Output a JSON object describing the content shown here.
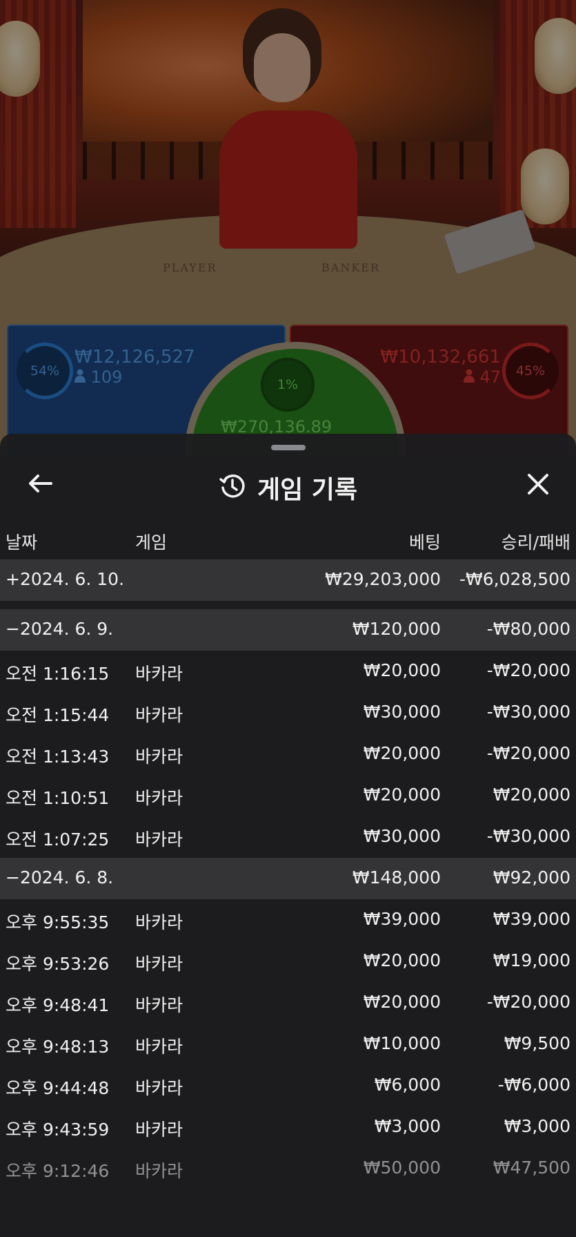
{
  "live": {
    "table_labels": {
      "player": "PLAYER",
      "banker": "BANKER"
    },
    "player_panel": {
      "percent": "54%",
      "amount": "₩12,126,527",
      "players": "109"
    },
    "banker_panel": {
      "percent": "45%",
      "amount": "₩10,132,661",
      "players": "47"
    },
    "tie_panel": {
      "percent": "1%",
      "amount": "₩270,136.89"
    }
  },
  "sheet": {
    "title": "게임 기록",
    "icons": {
      "back": "arrow-left-icon",
      "history": "history-icon",
      "close": "close-icon",
      "user": "user-icon"
    },
    "columns": {
      "date": "날짜",
      "game": "게임",
      "bet": "베팅",
      "win_loss": "승리/패배"
    },
    "rows": [
      {
        "type": "day",
        "date": "+2024. 6. 10.",
        "game": "",
        "bet": "₩29,203,000",
        "win_loss": "-₩6,028,500"
      },
      {
        "type": "day",
        "date": "−2024. 6. 9.",
        "game": "",
        "bet": "₩120,000",
        "win_loss": "-₩80,000"
      },
      {
        "type": "entry",
        "date": "오전 1:16:15",
        "game": "바카라",
        "bet": "₩20,000",
        "win_loss": "-₩20,000"
      },
      {
        "type": "entry",
        "date": "오전 1:15:44",
        "game": "바카라",
        "bet": "₩30,000",
        "win_loss": "-₩30,000"
      },
      {
        "type": "entry",
        "date": "오전 1:13:43",
        "game": "바카라",
        "bet": "₩20,000",
        "win_loss": "-₩20,000"
      },
      {
        "type": "entry",
        "date": "오전 1:10:51",
        "game": "바카라",
        "bet": "₩20,000",
        "win_loss": "₩20,000"
      },
      {
        "type": "entry",
        "date": "오전 1:07:25",
        "game": "바카라",
        "bet": "₩30,000",
        "win_loss": "-₩30,000"
      },
      {
        "type": "day",
        "date": "−2024. 6. 8.",
        "game": "",
        "bet": "₩148,000",
        "win_loss": "₩92,000"
      },
      {
        "type": "entry",
        "date": "오후 9:55:35",
        "game": "바카라",
        "bet": "₩39,000",
        "win_loss": "₩39,000"
      },
      {
        "type": "entry",
        "date": "오후 9:53:26",
        "game": "바카라",
        "bet": "₩20,000",
        "win_loss": "₩19,000"
      },
      {
        "type": "entry",
        "date": "오후 9:48:41",
        "game": "바카라",
        "bet": "₩20,000",
        "win_loss": "-₩20,000"
      },
      {
        "type": "entry",
        "date": "오후 9:48:13",
        "game": "바카라",
        "bet": "₩10,000",
        "win_loss": "₩9,500"
      },
      {
        "type": "entry",
        "date": "오후 9:44:48",
        "game": "바카라",
        "bet": "₩6,000",
        "win_loss": "-₩6,000"
      },
      {
        "type": "entry",
        "date": "오후 9:43:59",
        "game": "바카라",
        "bet": "₩3,000",
        "win_loss": "₩3,000"
      },
      {
        "type": "entry",
        "date": "오후 9:12:46",
        "game": "바카라",
        "bet": "₩50,000",
        "win_loss": "₩47,500"
      }
    ]
  }
}
